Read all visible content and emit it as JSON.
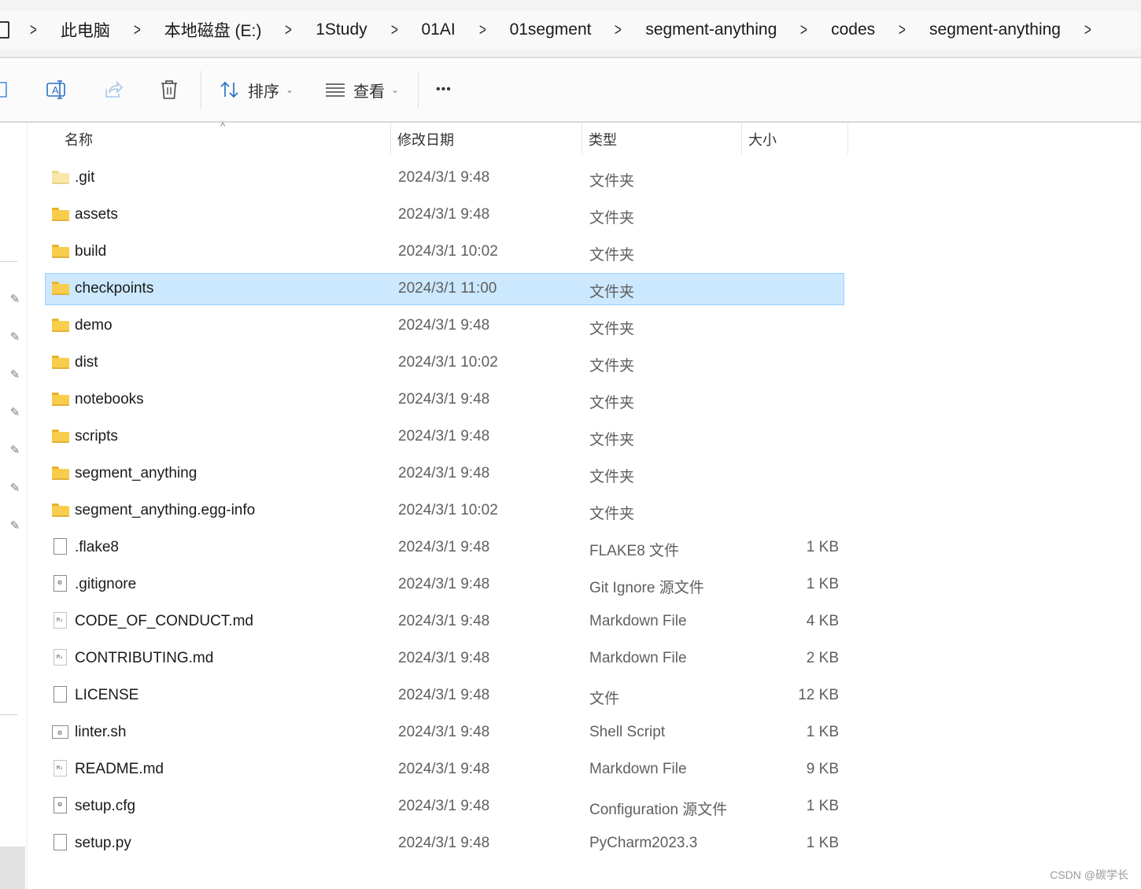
{
  "breadcrumb": [
    "此电脑",
    "本地磁盘 (E:)",
    "1Study",
    "01AI",
    "01segment",
    "segment-anything",
    "codes",
    "segment-anything"
  ],
  "toolbar": {
    "sort_label": "排序",
    "view_label": "查看",
    "more_label": "•••"
  },
  "columns": {
    "name": "名称",
    "date": "修改日期",
    "type": "类型",
    "size": "大小"
  },
  "files": [
    {
      "name": ".git",
      "date": "2024/3/1 9:48",
      "type": "文件夹",
      "size": "",
      "icon": "folder-hidden-icon"
    },
    {
      "name": "assets",
      "date": "2024/3/1 9:48",
      "type": "文件夹",
      "size": "",
      "icon": "folder-icon"
    },
    {
      "name": "build",
      "date": "2024/3/1 10:02",
      "type": "文件夹",
      "size": "",
      "icon": "folder-icon"
    },
    {
      "name": "checkpoints",
      "date": "2024/3/1 11:00",
      "type": "文件夹",
      "size": "",
      "icon": "folder-icon",
      "selected": true
    },
    {
      "name": "demo",
      "date": "2024/3/1 9:48",
      "type": "文件夹",
      "size": "",
      "icon": "folder-icon"
    },
    {
      "name": "dist",
      "date": "2024/3/1 10:02",
      "type": "文件夹",
      "size": "",
      "icon": "folder-icon"
    },
    {
      "name": "notebooks",
      "date": "2024/3/1 9:48",
      "type": "文件夹",
      "size": "",
      "icon": "folder-icon"
    },
    {
      "name": "scripts",
      "date": "2024/3/1 9:48",
      "type": "文件夹",
      "size": "",
      "icon": "folder-icon"
    },
    {
      "name": "segment_anything",
      "date": "2024/3/1 9:48",
      "type": "文件夹",
      "size": "",
      "icon": "folder-icon"
    },
    {
      "name": "segment_anything.egg-info",
      "date": "2024/3/1 10:02",
      "type": "文件夹",
      "size": "",
      "icon": "folder-icon"
    },
    {
      "name": ".flake8",
      "date": "2024/3/1 9:48",
      "type": "FLAKE8 文件",
      "size": "1 KB",
      "icon": "blank-file-icon"
    },
    {
      "name": ".gitignore",
      "date": "2024/3/1 9:48",
      "type": "Git Ignore 源文件",
      "size": "1 KB",
      "icon": "settings-file-icon"
    },
    {
      "name": "CODE_OF_CONDUCT.md",
      "date": "2024/3/1 9:48",
      "type": "Markdown File",
      "size": "4 KB",
      "icon": "markdown-file-icon"
    },
    {
      "name": "CONTRIBUTING.md",
      "date": "2024/3/1 9:48",
      "type": "Markdown File",
      "size": "2 KB",
      "icon": "markdown-file-icon"
    },
    {
      "name": "LICENSE",
      "date": "2024/3/1 9:48",
      "type": "文件",
      "size": "12 KB",
      "icon": "blank-file-icon"
    },
    {
      "name": "linter.sh",
      "date": "2024/3/1 9:48",
      "type": "Shell Script",
      "size": "1 KB",
      "icon": "shell-script-icon"
    },
    {
      "name": "README.md",
      "date": "2024/3/1 9:48",
      "type": "Markdown File",
      "size": "9 KB",
      "icon": "markdown-file-icon"
    },
    {
      "name": "setup.cfg",
      "date": "2024/3/1 9:48",
      "type": "Configuration 源文件",
      "size": "1 KB",
      "icon": "settings-file-icon"
    },
    {
      "name": "setup.py",
      "date": "2024/3/1 9:48",
      "type": "PyCharm2023.3",
      "size": "1 KB",
      "icon": "blank-file-icon"
    }
  ],
  "watermark": "CSDN @碳学长",
  "colors": {
    "selected_bg": "#cce8ff",
    "folder": "#f8cd4b"
  }
}
